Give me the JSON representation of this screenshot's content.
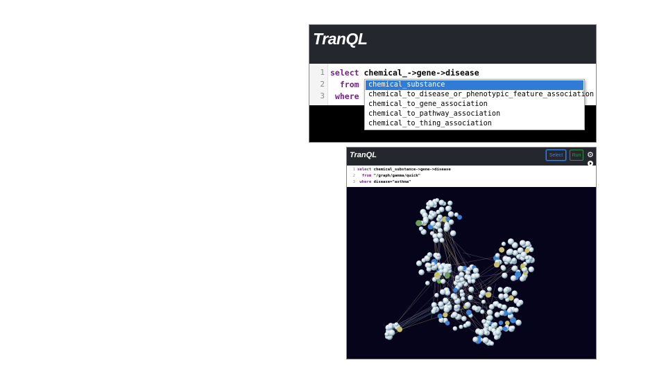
{
  "top_panel": {
    "title": "TranQL",
    "lines": [
      {
        "num": "1",
        "kw": "select",
        "text": " chemical_->gene->disease"
      },
      {
        "num": "2",
        "kw": "  from",
        "text": ""
      },
      {
        "num": "3",
        "kw": " where",
        "text": ""
      }
    ],
    "autocomplete": [
      "chemical_substance",
      "chemical_to_disease_or_phenotypic_feature_association",
      "chemical_to_gene_association",
      "chemical_to_pathway_association",
      "chemical_to_thing_association"
    ],
    "selected_index": 0
  },
  "bottom_panel": {
    "title": "TranQL",
    "select_label": "Select",
    "run_label": "Run",
    "gear_icon": "gear-icon",
    "play_icon": "play-icon",
    "lines": [
      {
        "num": "1",
        "kw": "select",
        "text": " chemical_substance->gene->disease"
      },
      {
        "num": "2",
        "kw": "  from",
        "text": " \"/graph/gamma/quick\""
      },
      {
        "num": "3",
        "kw": " where",
        "text": " disease=\"asthma\""
      }
    ],
    "graph": {
      "background": "#05041a",
      "node_color": "#c8dce6",
      "accent_colors": [
        "#3b82d6",
        "#c8c070",
        "#6a9e5a"
      ]
    }
  }
}
